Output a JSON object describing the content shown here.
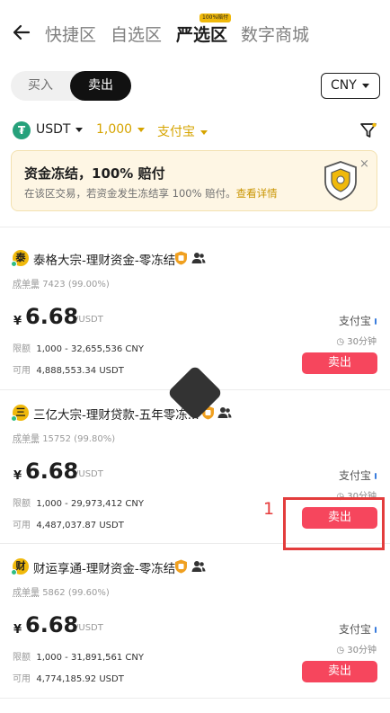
{
  "nav": {
    "back_icon": "arrow-left-icon",
    "tabs": [
      {
        "label": "快捷区",
        "active": false
      },
      {
        "label": "自选区",
        "active": false
      },
      {
        "label": "严选区",
        "active": true
      },
      {
        "label": "数字商城",
        "active": false
      }
    ],
    "tag": "100%赔付"
  },
  "segment": {
    "buy": "买入",
    "sell": "卖出",
    "selected": "sell"
  },
  "currency": {
    "value": "CNY"
  },
  "filters": {
    "coin": "USDT",
    "amount": "1,000",
    "payment": "支付宝",
    "filter_icon": "funnel-icon"
  },
  "banner": {
    "title": "资金冻结，100% 赔付",
    "desc": "在该区交易，若资金发生冻结享 100% 赔付。",
    "link": "查看详情",
    "close": "×",
    "icon": "shield-badge-icon"
  },
  "listings": [
    {
      "avatar": "泰",
      "merchant": "泰格大宗-理财资金-零冻结",
      "orders_label": "成单量",
      "orders": "7423 (99.00%)",
      "price_symbol": "¥",
      "price": "6.68",
      "price_unit": "/USDT",
      "limit_label": "限额",
      "limit": "1,000 - 32,655,536 CNY",
      "available_label": "可用",
      "available": "4,888,553.34 USDT",
      "payment": "支付宝",
      "time": "30分钟",
      "button": "卖出"
    },
    {
      "avatar": "三",
      "merchant": "三亿大宗-理财贷款-五年零冻...",
      "orders_label": "成单量",
      "orders": "15752 (99.80%)",
      "price_symbol": "¥",
      "price": "6.68",
      "price_unit": "/USDT",
      "limit_label": "限额",
      "limit": "1,000 - 29,973,412 CNY",
      "available_label": "可用",
      "available": "4,487,037.87 USDT",
      "payment": "支付宝",
      "time": "30分钟",
      "button": "卖出"
    },
    {
      "avatar": "财",
      "merchant": "财运享通-理财资金-零冻结",
      "orders_label": "成单量",
      "orders": "5862 (99.60%)",
      "price_symbol": "¥",
      "price": "6.68",
      "price_unit": "/USDT",
      "limit_label": "限额",
      "limit": "1,000 - 31,891,561 CNY",
      "available_label": "可用",
      "available": "4,774,185.92 USDT",
      "payment": "支付宝",
      "time": "30分钟",
      "button": "卖出"
    }
  ],
  "annotation": {
    "label": "1"
  },
  "colors": {
    "accent_gold": "#f0b90b",
    "sell_red": "#f6465d",
    "annotation_red": "#e33c3c"
  }
}
